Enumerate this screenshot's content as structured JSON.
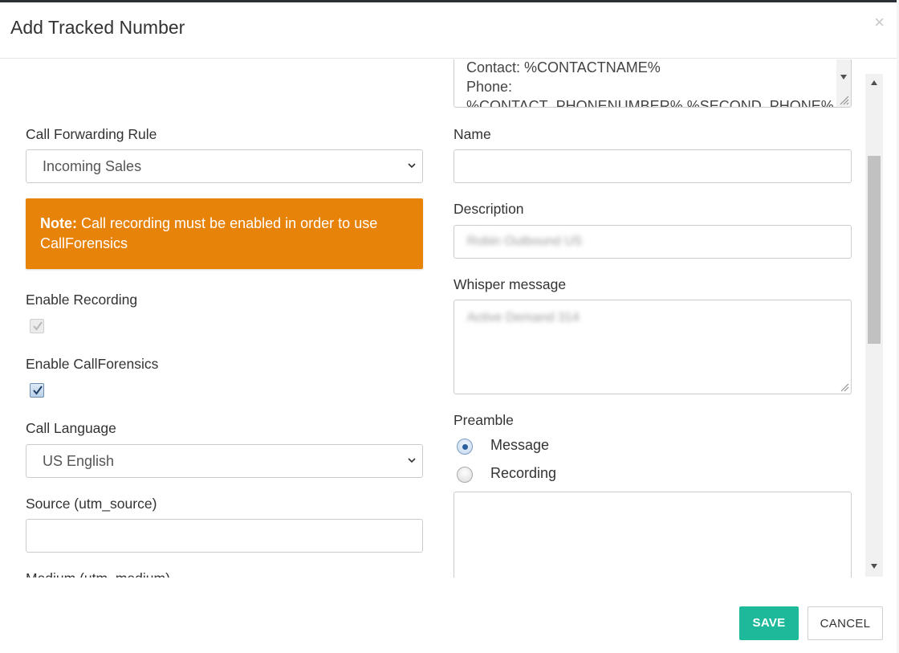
{
  "modal": {
    "title": "Add Tracked Number",
    "close_symbol": "×"
  },
  "left": {
    "call_forwarding_label": "Call Forwarding Rule",
    "call_forwarding_value": "Incoming Sales",
    "note_bold": "Note:",
    "note_text": " Call recording must be enabled in order to use CallForensics",
    "enable_recording_label": "Enable Recording",
    "enable_recording_checked": true,
    "enable_callforensics_label": "Enable CallForensics",
    "enable_callforensics_checked": true,
    "call_language_label": "Call Language",
    "call_language_value": "US English",
    "source_label": "Source (utm_source)",
    "source_value": "",
    "medium_label_partial": "Medium (utm_medium)"
  },
  "right": {
    "template_text_line1": "Contact: %CONTACTNAME%",
    "template_text_line2": "Phone:",
    "template_text_line3": "%CONTACT_PHONENUMBER% %SECOND_PHONE%",
    "name_label": "Name",
    "name_value": "",
    "description_label": "Description",
    "description_value_blurred": "Robin Outbound US",
    "whisper_label": "Whisper message",
    "whisper_value_blurred": "Active Demand 314",
    "preamble_label": "Preamble",
    "preamble_options": [
      {
        "label": "Message",
        "selected": true
      },
      {
        "label": "Recording",
        "selected": false
      }
    ],
    "preamble_text": ""
  },
  "footer": {
    "save_label": "SAVE",
    "cancel_label": "CANCEL"
  },
  "colors": {
    "note_bg": "#e8830a",
    "save_bg": "#1db99a"
  },
  "icons": [
    "close-icon",
    "chevron-down-icon",
    "checkmark-icon",
    "scroll-up-arrow-icon",
    "scroll-down-arrow-icon",
    "resize-grip-icon"
  ]
}
